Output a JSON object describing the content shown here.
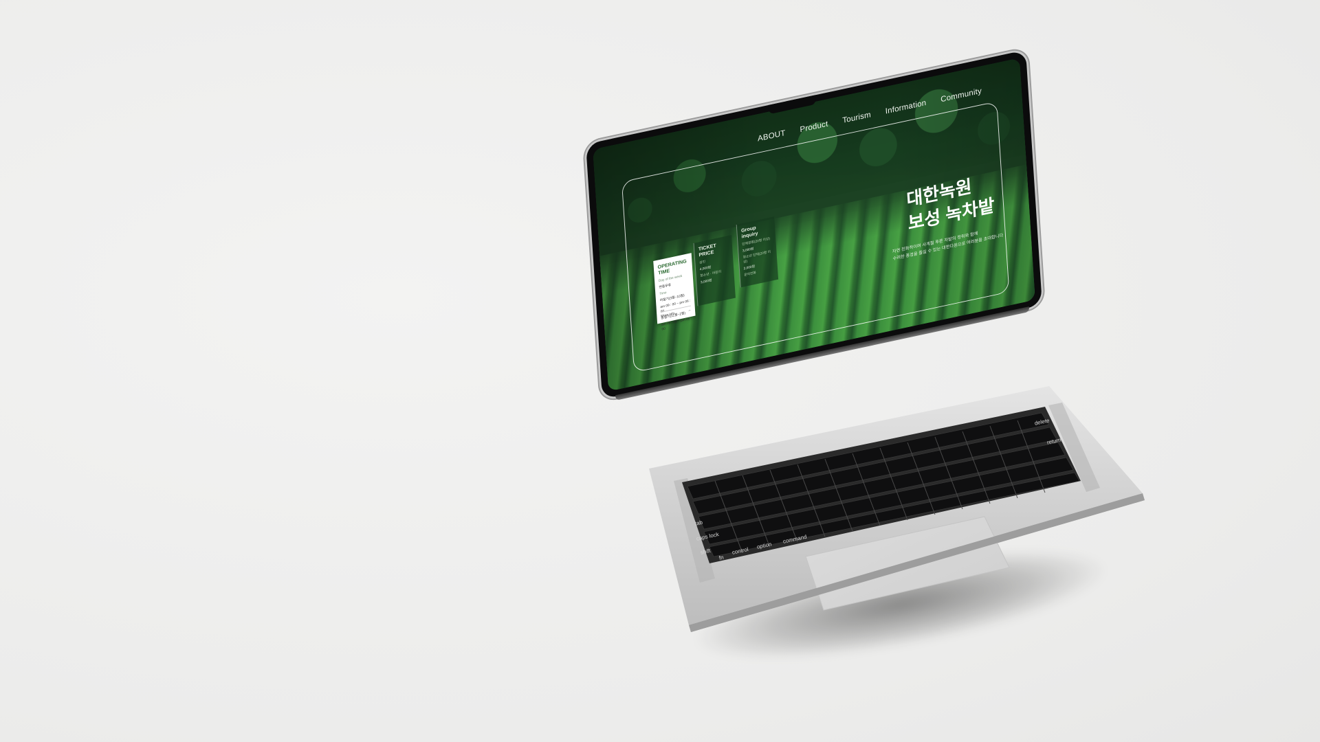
{
  "screen": {
    "nav": [
      "ABOUT",
      "Product",
      "Tourism",
      "Information",
      "Community"
    ],
    "hero": {
      "title_line1": "대한녹원",
      "title_line2": "보성 녹차밭",
      "subtitle_line1": "자연 친화적이며 사계절 푸른 차밭의 정취와 함께",
      "subtitle_line2": "수려한 풍경을 즐길 수 있는 대한다원으로 여러분을 초대합니다"
    },
    "cards": {
      "operating": {
        "title_line1": "OPERATING",
        "title_line2": "TIME",
        "label_days": "Day of the week",
        "days": "연중무휴",
        "label_time": "Time",
        "time_1": "하절기(3월~10월)",
        "time_2": "am 09 : 00 ~ pm 06 : 00",
        "time_3": "동절기(11월~2월)",
        "time_4": "am 09 : 00 ~ pm 05 : 00",
        "more": "More info",
        "more_arrow": "→"
      },
      "ticket": {
        "title_line1": "TICKET",
        "title_line2": "PRICE",
        "line_1": "성인",
        "line_2": "4,000원",
        "line_3": "청소년 · 어린이",
        "line_4": "3,000원"
      },
      "group": {
        "title_line1": "Group",
        "title_line2": "inquiry",
        "line_1": "단체관람(20명 이상)",
        "line_2": "3,000원",
        "line_3": "청소년 단체(20명 이상)",
        "line_4": "2,000원",
        "line_5": "문의전화"
      }
    }
  },
  "keyboard": {
    "keys": [
      "tab",
      "caps lock",
      "shift",
      "fn",
      "control",
      "option",
      "command",
      "return",
      "delete"
    ]
  },
  "colors": {
    "background": "#efefee",
    "screen_green": "#2d6a34",
    "card_accent": "#2d6b33"
  }
}
